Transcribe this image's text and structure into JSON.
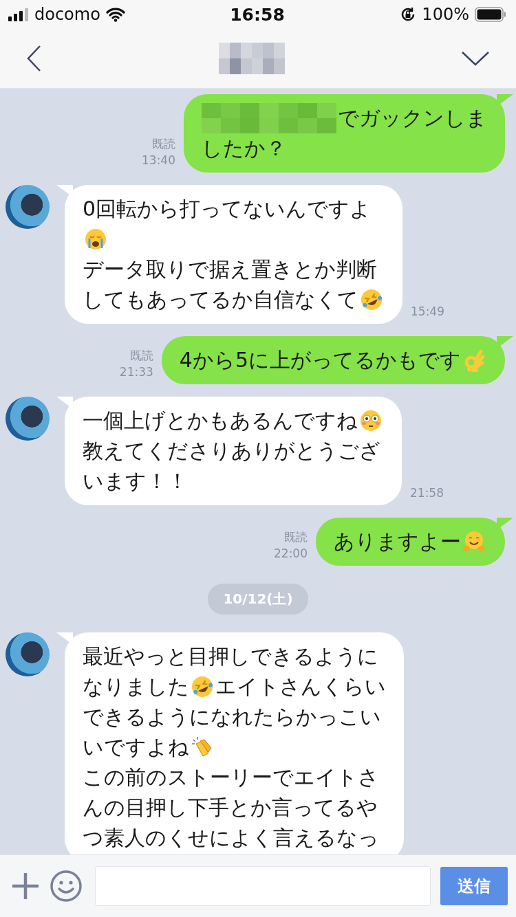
{
  "status_bar": {
    "carrier": "docomo",
    "time": "16:58",
    "battery": "100%"
  },
  "messages": [
    {
      "kind": "sent",
      "redacted": true,
      "read": "既読",
      "time": "13:40",
      "lines": [
        [
          {
            "kind": "text",
            "text": "でガックンしま"
          }
        ],
        [
          {
            "kind": "text",
            "text": "したか？"
          }
        ]
      ]
    },
    {
      "kind": "received",
      "time": "15:49",
      "lines": [
        [
          {
            "kind": "text",
            "text": "0回転から打ってないんですよ"
          }
        ],
        [
          {
            "kind": "crying"
          }
        ],
        [
          {
            "kind": "text",
            "text": "データ取りで据え置きとか判断"
          }
        ],
        [
          {
            "kind": "text",
            "text": "してもあってるか自信なくて"
          },
          {
            "kind": "rofl"
          }
        ]
      ]
    },
    {
      "kind": "sent",
      "read": "既読",
      "time": "21:33",
      "lines": [
        [
          {
            "kind": "text",
            "text": "4から5に上がってるかもです"
          },
          {
            "kind": "okhand"
          }
        ]
      ]
    },
    {
      "kind": "received",
      "time": "21:58",
      "lines": [
        [
          {
            "kind": "text",
            "text": "一個上げとかもあるんですね"
          },
          {
            "kind": "flushed"
          }
        ],
        [
          {
            "kind": "text",
            "text": "教えてくださりありがとうござ"
          }
        ],
        [
          {
            "kind": "text",
            "text": "います！！"
          }
        ]
      ]
    },
    {
      "kind": "sent",
      "read": "既読",
      "time": "22:00",
      "lines": [
        [
          {
            "kind": "text",
            "text": "ありますよー"
          },
          {
            "kind": "hugging"
          }
        ]
      ]
    },
    {
      "kind": "date",
      "text": "10/12(土)"
    },
    {
      "kind": "received",
      "lines": [
        [
          {
            "kind": "text",
            "text": "最近やっと目押しできるように"
          }
        ],
        [
          {
            "kind": "text",
            "text": "なりました"
          },
          {
            "kind": "rofl"
          },
          {
            "kind": "text",
            "text": "エイトさんくらい"
          }
        ],
        [
          {
            "kind": "text",
            "text": "できるようになれたらかっこい"
          }
        ],
        [
          {
            "kind": "text",
            "text": "いですよね"
          },
          {
            "kind": "clap"
          }
        ],
        [
          {
            "kind": "text",
            "text": "この前のストーリーでエイトさ"
          }
        ],
        [
          {
            "kind": "text",
            "text": "んの目押し下手とか言ってるや"
          }
        ],
        [
          {
            "kind": "text",
            "text": "つ素人のくせによく言えるなっ"
          }
        ]
      ]
    }
  ],
  "composer": {
    "send": "送信"
  }
}
